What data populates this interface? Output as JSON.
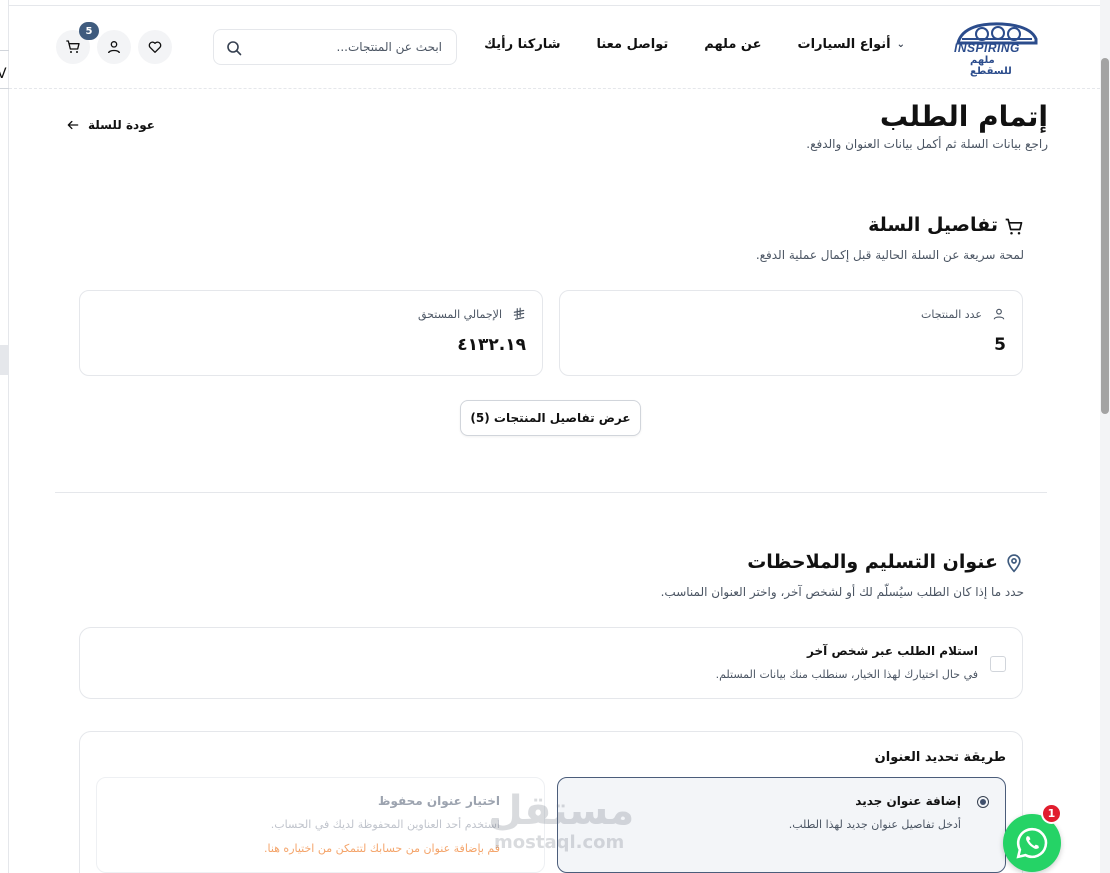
{
  "header": {
    "logo_text": "INSPIRING",
    "logo_sub": "ملهم للسقطع",
    "nav": [
      {
        "label": "أنواع السيارات",
        "has_dropdown": true
      },
      {
        "label": "عن ملهم"
      },
      {
        "label": "تواصل معنا"
      },
      {
        "label": "شاركنا رأيك"
      }
    ],
    "search_placeholder": "ابحث عن المنتجات...",
    "cart_count": "5",
    "icons": [
      "heart-icon",
      "user-icon",
      "cart-icon",
      "search-icon"
    ]
  },
  "page": {
    "title": "إتمام الطلب",
    "subtitle": "راجع بيانات السلة ثم أكمل بيانات العنوان والدفع.",
    "back_label": "عودة للسلة"
  },
  "cart_section": {
    "title": "تفاصيل السلة",
    "subtitle": "لمحة سريعة عن السلة الحالية قبل إكمال عملية الدفع.",
    "products_count_label": "عدد المنتجات",
    "products_count_value": "5",
    "total_label": "الإجمالي المستحق",
    "total_value": "٤١٣٢.١٩",
    "view_details_button": "عرض تفاصيل المنتجات (5)"
  },
  "delivery_section": {
    "title": "عنوان التسليم والملاحظات",
    "subtitle": "حدد ما إذا كان الطلب سيُسلّم لك أو لشخص آخر، واختر العنوان المناسب.",
    "other_person_title": "استلام الطلب عبر شخص آخر",
    "other_person_desc": "في حال اختيارك لهذا الخيار، سنطلب منك بيانات المستلم.",
    "method_title": "طريقة تحديد العنوان",
    "new_address_title": "إضافة عنوان جديد",
    "new_address_desc": "أدخل تفاصيل عنوان جديد لهذا الطلب.",
    "saved_address_title": "اختيار عنوان محفوظ",
    "saved_address_desc": "استخدم أحد العناوين المحفوظة لديك في الحساب.",
    "saved_address_warning": "قم بإضافة عنوان من حسابك لتتمكن من اختياره هنا."
  },
  "watermark": {
    "ar": "مستقل",
    "en": "mostaql.com"
  },
  "whatsapp": {
    "badge": "1"
  },
  "colors": {
    "accent": "#3f5b7e",
    "whatsapp": "#25d366",
    "warning": "#f4a46a",
    "badge_red": "#e11d2e"
  }
}
